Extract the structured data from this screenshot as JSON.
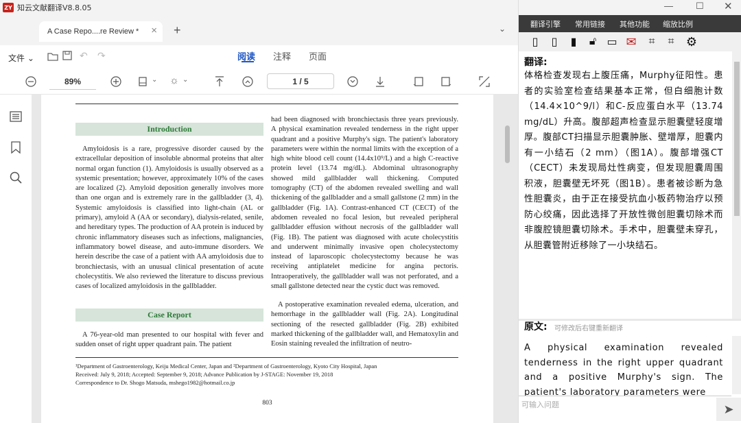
{
  "app": {
    "title": "知云文献翻译V8.8.05",
    "logo": "ZY"
  },
  "tab": {
    "label": "A Case Repo....re Review *"
  },
  "toolbar": {
    "file_label": "文件",
    "modes": [
      "阅读",
      "注释",
      "页面"
    ],
    "zoom": "89%",
    "page": "1 / 5"
  },
  "document": {
    "col1_heading": "Introduction",
    "col1_text": "Amyloidosis is a rare, progressive disorder caused by the extracellular deposition of insoluble abnormal proteins that alter normal organ function (1). Amyloidosis is usually observed as a systemic presentation; however, approximately 10% of the cases are localized (2). Amyloid deposition generally involves more than one organ and is extremely rare in the gallbladder (3, 4). Systemic amyloidosis is classified into light-chain (AL or primary), amyloid A (AA or secondary), dialysis-related, senile, and hereditary types. The production of AA protein is induced by chronic inflammatory diseases such as infections, malignancies, inflammatory bowel disease, and auto-immune disorders. We herein describe the case of a patient with AA amyloidosis due to bronchiectasis, with an unusual clinical presentation of acute cholecystitis. We also reviewed the literature to discuss previous cases of localized amyloidosis in the gallbladder.",
    "col1_heading2": "Case Report",
    "col1_text2": "A 76-year-old man presented to our hospital with fever and sudden onset of right upper quadrant pain. The patient",
    "col2_text": "had been diagnosed with bronchiectasis three years previously. A physical examination revealed tenderness in the right upper quadrant and a positive Murphy's sign. The patient's laboratory parameters were within the normal limits with the exception of a high white blood cell count (14.4x10⁹/L) and a high C-reactive protein level (13.74 mg/dL). Abdominal ultrasonography showed mild gallbladder wall thickening. Computed tomography (CT) of the abdomen revealed swelling and wall thickening of the gallbladder and a small gallstone (2 mm) in the gallbladder (Fig. 1A). Contrast-enhanced CT (CECT) of the abdomen revealed no focal lesion, but revealed peripheral gallbladder effusion without necrosis of the gallbladder wall (Fig. 1B). The patient was diagnosed with acute cholecystitis and underwent minimally invasive open cholecystectomy instead of laparoscopic cholecystectomy because he was receiving antiplatelet medicine for angina pectoris. Intraoperatively, the gallbladder wall was not perforated, and a small gallstone detected near the cystic duct was removed.",
    "col2_text2": "A postoperative examination revealed edema, ulceration, and hemorrhage in the gallbladder wall (Fig. 2A). Longitudinal sectioning of the resected gallbladder (Fig. 2B) exhibited marked thickening of the gallbladder wall, and Hematoxylin and Eosin staining revealed the infiltration of neutro-",
    "footnote1": "¹Department of Gastroenterology, Keiju Medical Center, Japan and ²Department of Gastroenterology, Kyoto City Hospital, Japan",
    "footnote2": "Received: July 9, 2018; Accepted: September 9, 2018; Advance Publication by J-STAGE: November 19, 2018",
    "footnote3": "Correspondence to Dr. Shogo Matsuda, mshego1982@hotmail.co.jp",
    "page_number": "803"
  },
  "panel": {
    "menu": [
      "翻译引擎",
      "常用链接",
      "其他功能",
      "缩放比例"
    ],
    "translation_label": "翻译:",
    "translation_text": "体格检查发现右上腹压痛，Murphy征阳性。患者的实验室检查结果基本正常，但白细胞计数（14.4×10^9/l）和C-反应蛋白水平（13.74 mg/dL）升高。腹部超声检查显示胆囊壁轻度增厚。腹部CT扫描显示胆囊肿胀、壁增厚，胆囊内有一小结石（2 mm）（图1A）。腹部增强CT（CECT）未发现局灶性病变，但发现胆囊周围积液，胆囊壁无坏死（图1B）。患者被诊断为急性胆囊炎，由于正在接受抗血小板药物治疗以预防心绞痛，因此选择了开放性微创胆囊切除术而非腹腔镜胆囊切除术。手术中，胆囊壁未穿孔，从胆囊管附近移除了一小块结石。",
    "original_label": "原文:",
    "original_hint": "可修改后右键重新翻译",
    "original_text": "A physical examination revealed tenderness in the right upper quadrant and a positive Murphy's sign. The patient's laboratory parameters were",
    "input_placeholder": "可输入问题"
  }
}
